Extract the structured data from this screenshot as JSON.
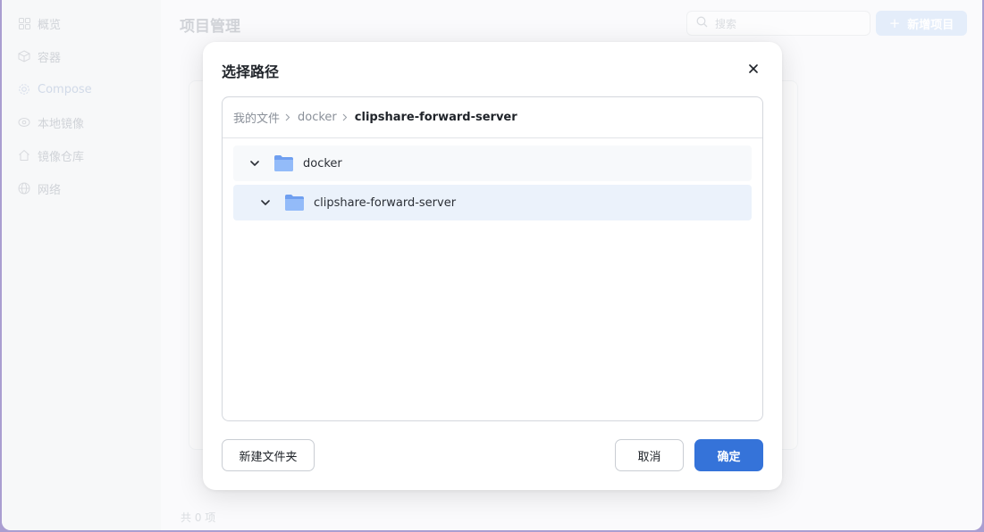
{
  "app": {
    "sidebar": {
      "items": [
        {
          "label": "概览",
          "icon": "grid-icon"
        },
        {
          "label": "容器",
          "icon": "cube-icon"
        },
        {
          "label": "Compose",
          "icon": "gear-icon"
        },
        {
          "label": "本地镜像",
          "icon": "image-icon"
        },
        {
          "label": "镜像仓库",
          "icon": "house-icon"
        },
        {
          "label": "网络",
          "icon": "globe-icon"
        }
      ]
    },
    "main": {
      "title": "项目管理",
      "search_placeholder": "搜索",
      "add_button_label": "新增项目",
      "footer_count": "共 0 项"
    }
  },
  "dialog": {
    "title": "选择路径",
    "breadcrumb": [
      "我的文件",
      "docker",
      "clipshare-forward-server"
    ],
    "tree": [
      {
        "name": "docker",
        "expanded": true,
        "selected": false
      },
      {
        "name": "clipshare-forward-server",
        "expanded": true,
        "selected": true
      }
    ],
    "buttons": {
      "new_folder": "新建文件夹",
      "cancel": "取消",
      "confirm": "确定"
    }
  },
  "colors": {
    "primary": "#3573d9",
    "folder": "#8ab4f8",
    "selected_row": "#ebf2fb"
  }
}
